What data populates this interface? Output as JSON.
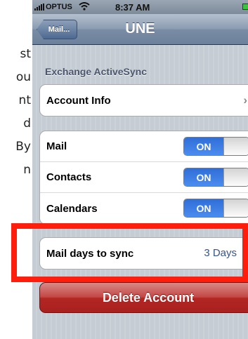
{
  "instruction_fragments": [
    "st",
    "ou",
    "nt",
    "d",
    "By",
    "n"
  ],
  "status_bar": {
    "carrier": "OPTUS",
    "time": "8:37 AM",
    "wifi_icon": "wifi-icon",
    "signal_icon": "signal-bars-icon",
    "battery_color": "#3cc43c"
  },
  "nav": {
    "back_label": "Mail...",
    "title": "UNE"
  },
  "section_header": "Exchange ActiveSync",
  "account_info": {
    "label": "Account Info",
    "chevron": "›"
  },
  "sync_items": [
    {
      "label": "Mail",
      "toggle": "ON"
    },
    {
      "label": "Contacts",
      "toggle": "ON"
    },
    {
      "label": "Calendars",
      "toggle": "ON"
    }
  ],
  "mail_days": {
    "label": "Mail days to sync",
    "value": "3 Days",
    "chevron": "›"
  },
  "delete_button": "Delete Account",
  "colors": {
    "highlight": "#ff1d0b",
    "toggle_on": "#2f6ed6",
    "delete": "#b22623"
  }
}
